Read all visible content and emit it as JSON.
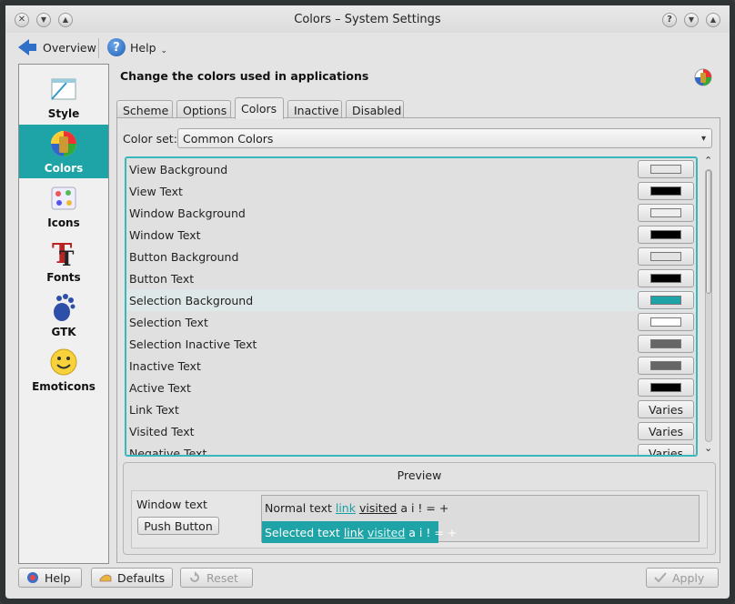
{
  "window": {
    "title": "Colors – System Settings"
  },
  "toolbar": {
    "overview_label": "Overview",
    "help_label": "Help"
  },
  "sidebar": {
    "items": [
      {
        "label": "Style"
      },
      {
        "label": "Colors"
      },
      {
        "label": "Icons"
      },
      {
        "label": "Fonts"
      },
      {
        "label": "GTK"
      },
      {
        "label": "Emoticons"
      }
    ]
  },
  "main": {
    "heading": "Change the colors used in applications",
    "tabs": [
      {
        "label": "Scheme"
      },
      {
        "label": "Options"
      },
      {
        "label": "Colors"
      },
      {
        "label": "Inactive"
      },
      {
        "label": "Disabled"
      }
    ],
    "color_set_label": "Color set:",
    "color_set_value": "Common Colors",
    "rows": [
      {
        "label": "View Background",
        "swatch": "#e6e6e6"
      },
      {
        "label": "View Text",
        "swatch": "#000000"
      },
      {
        "label": "Window Background",
        "swatch": "#eeeeee"
      },
      {
        "label": "Window Text",
        "swatch": "#000000"
      },
      {
        "label": "Button Background",
        "swatch": "#e2e2e2"
      },
      {
        "label": "Button Text",
        "swatch": "#000000"
      },
      {
        "label": "Selection Background",
        "swatch": "#1ea3a6"
      },
      {
        "label": "Selection Text",
        "swatch": "#ffffff"
      },
      {
        "label": "Selection Inactive Text",
        "swatch": "#666666"
      },
      {
        "label": "Inactive Text",
        "swatch": "#666666"
      },
      {
        "label": "Active Text",
        "swatch": "#000000"
      },
      {
        "label": "Link Text",
        "button_text": "Varies"
      },
      {
        "label": "Visited Text",
        "button_text": "Varies"
      },
      {
        "label": "Negative Text",
        "button_text": "Varies"
      }
    ],
    "preview": {
      "title": "Preview",
      "window_text": "Window text",
      "push_button": "Push Button",
      "normal_text": "Normal text",
      "link": "link",
      "visited": "visited",
      "chars": "a i ! = +",
      "selected_text": "Selected text",
      "sel_link": "link",
      "sel_visited": "visited",
      "sel_chars": "a i ! = +"
    }
  },
  "buttons": {
    "help": "Help",
    "defaults": "Defaults",
    "reset": "Reset",
    "apply": "Apply"
  },
  "colors": {
    "accent": "#1ea3a6",
    "list_border": "#37b8ba"
  }
}
